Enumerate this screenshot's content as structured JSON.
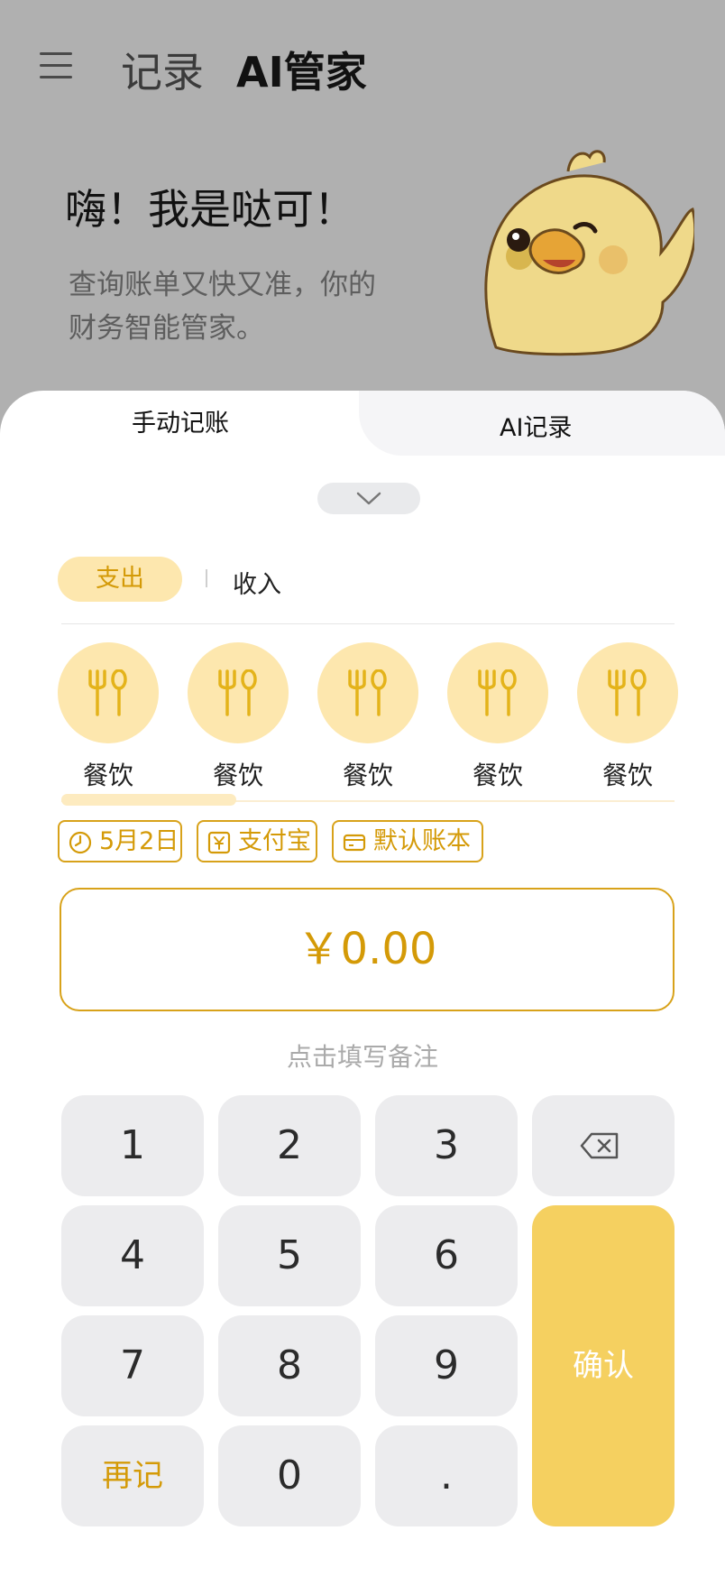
{
  "header": {
    "tab_record": "记录",
    "tab_ai": "AI管家",
    "menu_icon": "menu-icon"
  },
  "hero": {
    "title": "嗨！我是哒可！",
    "subtitle": "查询账单又快又准，你的财务智能管家。",
    "mascot": "duck-mascot"
  },
  "sheet": {
    "tabs": [
      {
        "label": "手动记账",
        "active": true
      },
      {
        "label": "AI记录",
        "active": false
      }
    ],
    "collapse_icon": "chevron-down-icon"
  },
  "type_toggle": {
    "expense": "支出",
    "income": "收入",
    "selected": "expense"
  },
  "categories": [
    {
      "label": "餐饮",
      "icon": "fork-spoon-icon"
    },
    {
      "label": "餐饮",
      "icon": "fork-spoon-icon"
    },
    {
      "label": "餐饮",
      "icon": "fork-spoon-icon"
    },
    {
      "label": "餐饮",
      "icon": "fork-spoon-icon"
    },
    {
      "label": "餐饮",
      "icon": "fork-spoon-icon"
    }
  ],
  "chips": {
    "date": "5月2日",
    "payment": "支付宝",
    "book": "默认账本"
  },
  "amount": {
    "display": "￥0.00"
  },
  "note_placeholder": "点击填写备注",
  "keypad": {
    "keys": [
      "1",
      "2",
      "3",
      "4",
      "5",
      "6",
      "7",
      "8",
      "9",
      "再记",
      "0",
      "."
    ],
    "backspace_icon": "backspace-icon",
    "confirm": "确认"
  },
  "colors": {
    "accent": "#d49a07",
    "accent_light": "#fde7ae",
    "confirm": "#f5d060",
    "key_bg": "#ececee",
    "overlay": "#b0b0b0"
  }
}
